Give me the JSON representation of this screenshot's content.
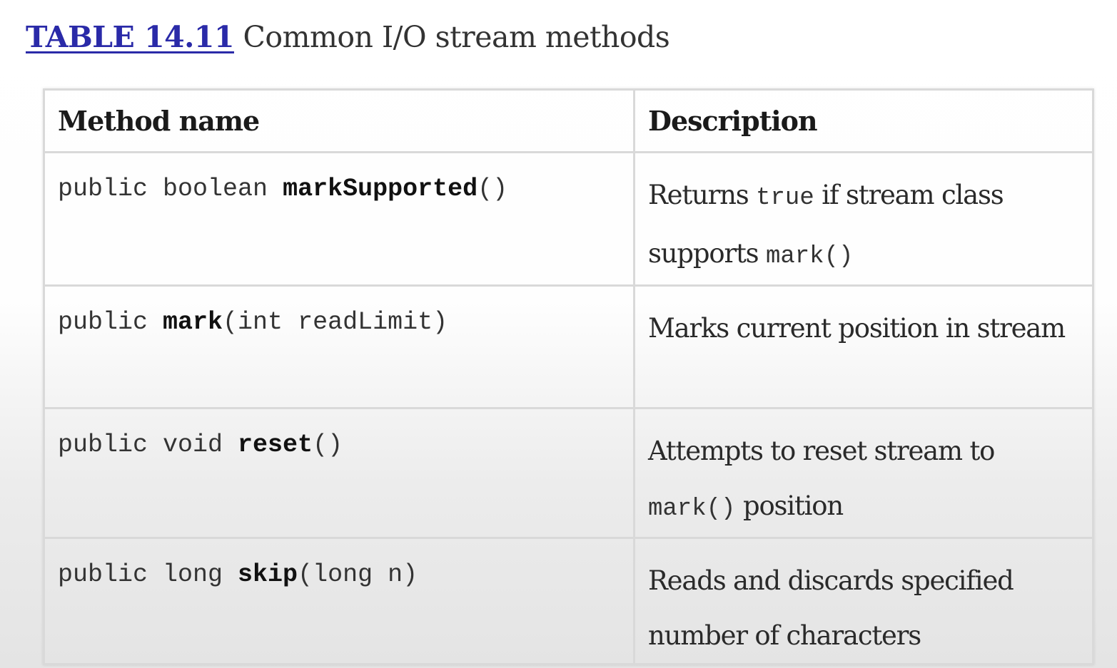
{
  "caption": {
    "table_label": "TABLE 14.11",
    "title": "Common I/O stream methods"
  },
  "table": {
    "headers": [
      "Method name",
      "Description"
    ],
    "rows": [
      {
        "sig_prefix": "public boolean ",
        "sig_name": "markSupported",
        "sig_suffix": "()",
        "desc_1": "Returns ",
        "desc_code_1": "true",
        "desc_2": " if stream class supports ",
        "desc_code_2": "mark()",
        "desc_3": ""
      },
      {
        "sig_prefix": "public ",
        "sig_name": "mark",
        "sig_suffix": "(int readLimit)",
        "desc_1": "Marks current position in stream",
        "desc_code_1": "",
        "desc_2": "",
        "desc_code_2": "",
        "desc_3": ""
      },
      {
        "sig_prefix": "public void ",
        "sig_name": "reset",
        "sig_suffix": "()",
        "desc_1": "Attempts to reset stream to ",
        "desc_code_1": "mark()",
        "desc_2": " position",
        "desc_code_2": "",
        "desc_3": ""
      },
      {
        "sig_prefix": "public long ",
        "sig_name": "skip",
        "sig_suffix": "(long n)",
        "desc_1": "Reads and discards specified number of characters",
        "desc_code_1": "",
        "desc_2": "",
        "desc_code_2": "",
        "desc_3": ""
      }
    ]
  }
}
